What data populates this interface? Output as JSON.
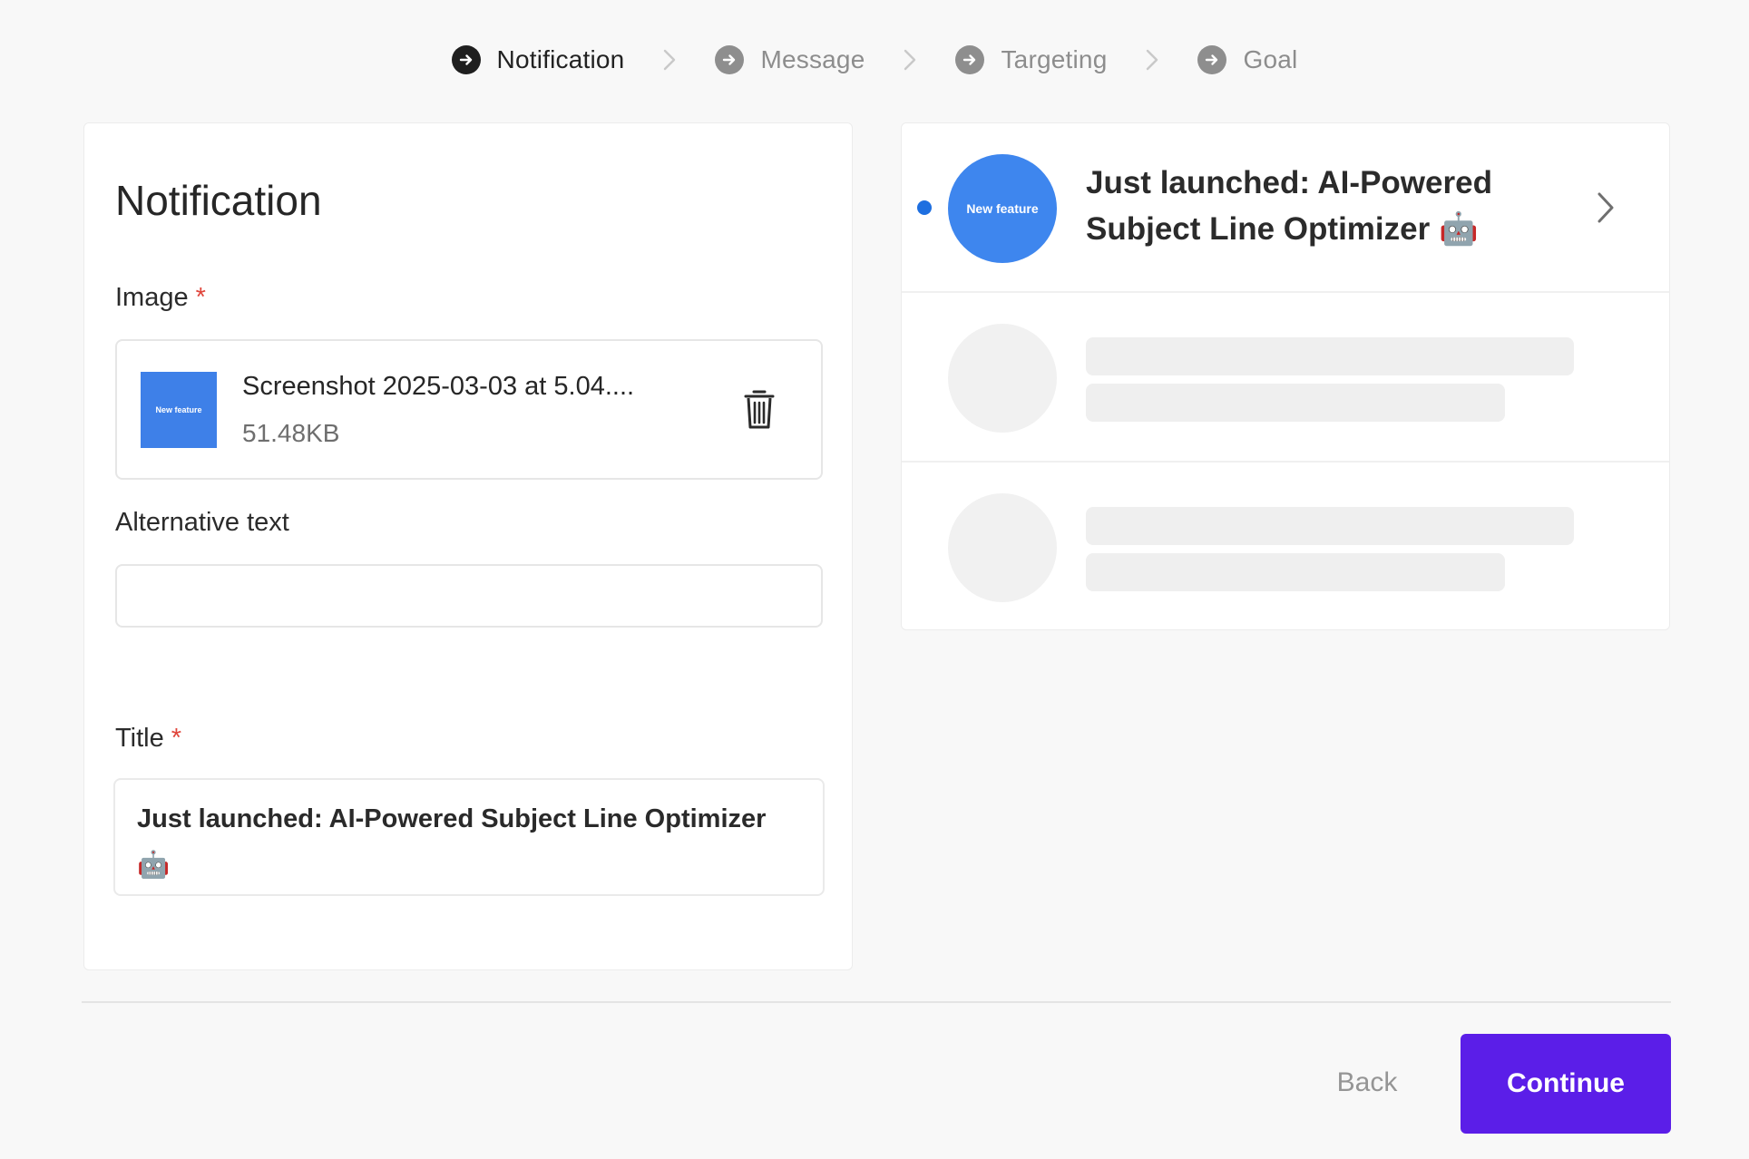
{
  "stepper": {
    "steps": [
      {
        "label": "Notification",
        "state": "active"
      },
      {
        "label": "Message",
        "state": "inactive"
      },
      {
        "label": "Targeting",
        "state": "inactive"
      },
      {
        "label": "Goal",
        "state": "inactive"
      }
    ]
  },
  "form": {
    "heading": "Notification",
    "image": {
      "label": "Image",
      "required_mark": "*",
      "thumbnail_text": "New feature",
      "file_name": "Screenshot 2025-03-03 at 5.04....",
      "file_size": "51.48KB"
    },
    "alt_text": {
      "label": "Alternative text",
      "value": ""
    },
    "title": {
      "label": "Title",
      "required_mark": "*",
      "value": "Just launched: AI-Powered Subject Line Optimizer 🤖"
    }
  },
  "preview": {
    "items": [
      {
        "avatar_text": "New feature",
        "title": "Just launched: AI-Powered Subject Line Optimizer 🤖",
        "unread": true
      }
    ]
  },
  "footer": {
    "back_label": "Back",
    "continue_label": "Continue"
  },
  "colors": {
    "primary": "#5b1ee8",
    "accent_blue": "#3e86ee",
    "unread_dot": "#1e6fe0",
    "required": "#e0453b"
  }
}
